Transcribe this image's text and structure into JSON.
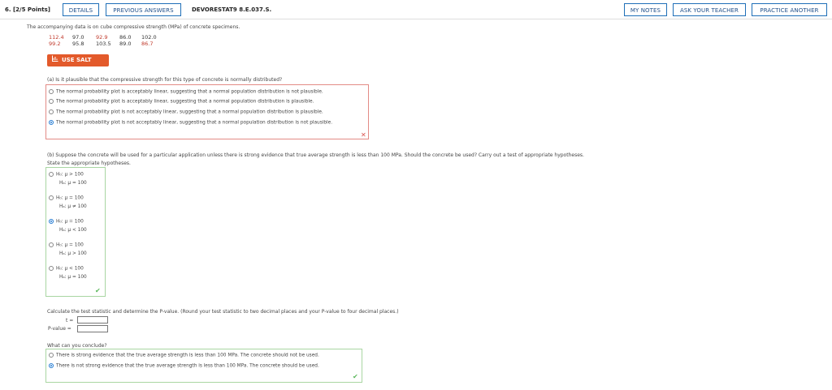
{
  "header": {
    "question_number": "6. [2/5 Points]",
    "details": "DETAILS",
    "previous_answers": "PREVIOUS ANSWERS",
    "code": "DEVORESTAT9 8.E.037.S.",
    "my_notes": "MY NOTES",
    "ask_teacher": "ASK YOUR TEACHER",
    "practice_another": "PRACTICE ANOTHER"
  },
  "intro": "The accompanying data is on cube compressive strength (MPa) of concrete specimens.",
  "data_rows": [
    [
      "112.4",
      "97.0",
      "92.9",
      "86.0",
      "102.0"
    ],
    [
      "99.2",
      "95.8",
      "103.5",
      "89.0",
      "86.7"
    ]
  ],
  "salt_button": "USE SALT",
  "part_a": {
    "question": "(a) Is it plausible that the compressive strength for this type of concrete is normally distributed?",
    "options": [
      "The normal probability plot is acceptably linear, suggesting that a normal population distribution is not plausible.",
      "The normal probability plot is acceptably linear, suggesting that a normal population distribution is plausible.",
      "The normal probability plot is not acceptably linear, suggesting that a normal population distribution is plausible.",
      "The normal probability plot is not acceptably linear, suggesting that a normal population distribution is not plausible."
    ],
    "selected": 3,
    "mark": "✕"
  },
  "part_b": {
    "question": "(b) Suppose the concrete will be used for a particular application unless there is strong evidence that true average strength is less than 100 MPa. Should the concrete be used? Carry out a test of appropriate hypotheses.",
    "state": "State the appropriate hypotheses.",
    "hypotheses": [
      {
        "h0": "H₀: μ > 100",
        "ha": "Hₐ: μ = 100"
      },
      {
        "h0": "H₀: μ = 100",
        "ha": "Hₐ: μ ≠ 100"
      },
      {
        "h0": "H₀: μ = 100",
        "ha": "Hₐ: μ < 100"
      },
      {
        "h0": "H₀: μ = 100",
        "ha": "Hₐ: μ > 100"
      },
      {
        "h0": "H₀: μ < 100",
        "ha": "Hₐ: μ = 100"
      }
    ],
    "selected": 2,
    "mark": "✔",
    "calc_prompt": "Calculate the test statistic and determine the P-value. (Round your test statistic to two decimal places and your P-value to four decimal places.)",
    "t_label": "t =",
    "p_label": "P-value =",
    "t_value": "",
    "p_value": "",
    "conclude_prompt": "What can you conclude?",
    "conclusions": [
      "There is strong evidence that the true average strength is less than 100 MPa. The concrete should not be used.",
      "There is not strong evidence that the true average strength is less than 100 MPa. The concrete should be used."
    ],
    "conclusion_selected": 1,
    "conclusion_mark": "✔"
  }
}
